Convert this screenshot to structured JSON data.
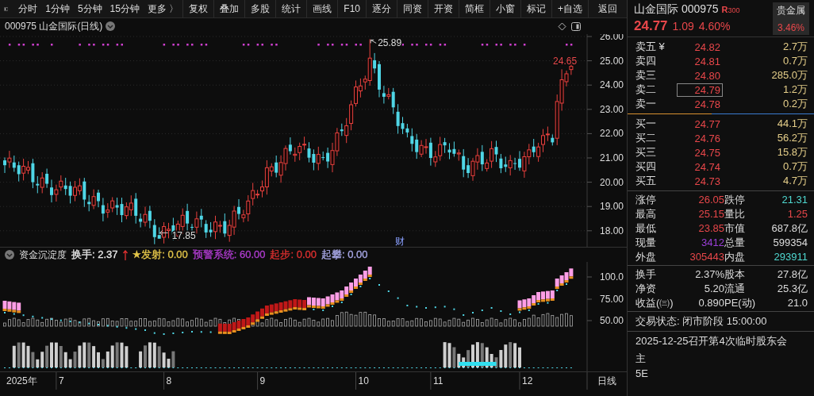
{
  "toolbar": {
    "periods": [
      "分时",
      "1分钟",
      "5分钟",
      "15分钟",
      "更多 〉"
    ],
    "buttons": [
      "复权",
      "叠加",
      "多股",
      "统计",
      "画线",
      "F10",
      "逐分",
      "同资",
      "开资",
      "简框",
      "小窗",
      "标记",
      "+自选",
      "返回"
    ]
  },
  "chart": {
    "title": "000975 山金国际(日线)",
    "price_axis": [
      "26.00",
      "25.00",
      "24.00",
      "23.00",
      "22.00",
      "21.00",
      "20.00",
      "19.00",
      "18.00"
    ],
    "high_label": "25.89",
    "low_label": "17.85",
    "last_label": "24.65",
    "event_mark": "财"
  },
  "indicator": {
    "name": "资金沉淀度",
    "items": [
      {
        "text": "换手: 2.37",
        "color": "#e8e8e8"
      },
      {
        "text": "★发射: 0.00",
        "color": "#e6c84a"
      },
      {
        "text": "预警系统: 60.00",
        "color": "#b03cd0"
      },
      {
        "text": "起步: 0.00",
        "color": "#e03030"
      },
      {
        "text": "起攀: 0.00",
        "color": "#a9a9e8"
      }
    ],
    "axis": [
      "100.0",
      "75.00",
      "50.00"
    ]
  },
  "date_axis": {
    "year": "2025年",
    "months": [
      "7",
      "8",
      "9",
      "10",
      "11",
      "12"
    ],
    "period": "日线"
  },
  "quote": {
    "name": "山金国际 000975",
    "badge": "R",
    "badge_number": "300",
    "price": "24.77",
    "change": "1.09",
    "change_pct": "4.60%",
    "sector": {
      "name": "贵金属",
      "change": "3.46%"
    },
    "asks": [
      {
        "label": "卖五 ¥",
        "price": "24.82",
        "volume": "2.7万",
        "selected": false
      },
      {
        "label": "卖四",
        "price": "24.81",
        "volume": "0.7万",
        "selected": false
      },
      {
        "label": "卖三",
        "price": "24.80",
        "volume": "285.0万",
        "selected": false
      },
      {
        "label": "卖二",
        "price": "24.79",
        "volume": "1.2万",
        "selected": true
      },
      {
        "label": "卖一",
        "price": "24.78",
        "volume": "0.2万",
        "selected": false
      }
    ],
    "bids": [
      {
        "label": "买一",
        "price": "24.77",
        "volume": "44.1万",
        "selected": false
      },
      {
        "label": "买二",
        "price": "24.76",
        "volume": "56.2万",
        "selected": false
      },
      {
        "label": "买三",
        "price": "24.75",
        "volume": "15.8万",
        "selected": false
      },
      {
        "label": "买四",
        "price": "24.74",
        "volume": "0.7万",
        "selected": false
      },
      {
        "label": "买五",
        "price": "24.73",
        "volume": "4.7万",
        "selected": false
      }
    ],
    "stats": [
      {
        "label": "涨停",
        "value": "26.05",
        "color": "#e8474a"
      },
      {
        "label": "跌停",
        "value": "21.31",
        "color": "#4fd8d0"
      },
      {
        "label": "最高",
        "value": "25.15",
        "color": "#e8474a"
      },
      {
        "label": "量比",
        "value": "1.25",
        "color": "#e8474a"
      },
      {
        "label": "最低",
        "value": "23.85",
        "color": "#e8474a"
      },
      {
        "label": "市值",
        "value": "687.8亿",
        "color": "#dddddd"
      },
      {
        "label": "现量",
        "value": "3412",
        "color": "#9a3fd8"
      },
      {
        "label": "总量",
        "value": "599354",
        "color": "#dddddd"
      },
      {
        "label": "外盘",
        "value": "305443",
        "color": "#e8474a"
      },
      {
        "label": "内盘",
        "value": "293911",
        "color": "#4fd8d0"
      }
    ],
    "fundamentals": [
      {
        "label": "换手",
        "value": "2.37%"
      },
      {
        "label": "股本",
        "value": "27.8亿"
      },
      {
        "label": "净资",
        "value": "5.20"
      },
      {
        "label": "流通",
        "value": "25.3亿"
      },
      {
        "label": "收益(㈢)",
        "value": "0.890"
      },
      {
        "label": "PE(动)",
        "value": "21.0"
      }
    ],
    "status": "交易状态: 闭市阶段 15:00:00",
    "notice": "2025-12-25召开第4次临时股东会",
    "cut_rows": [
      "主",
      "5E"
    ]
  }
}
